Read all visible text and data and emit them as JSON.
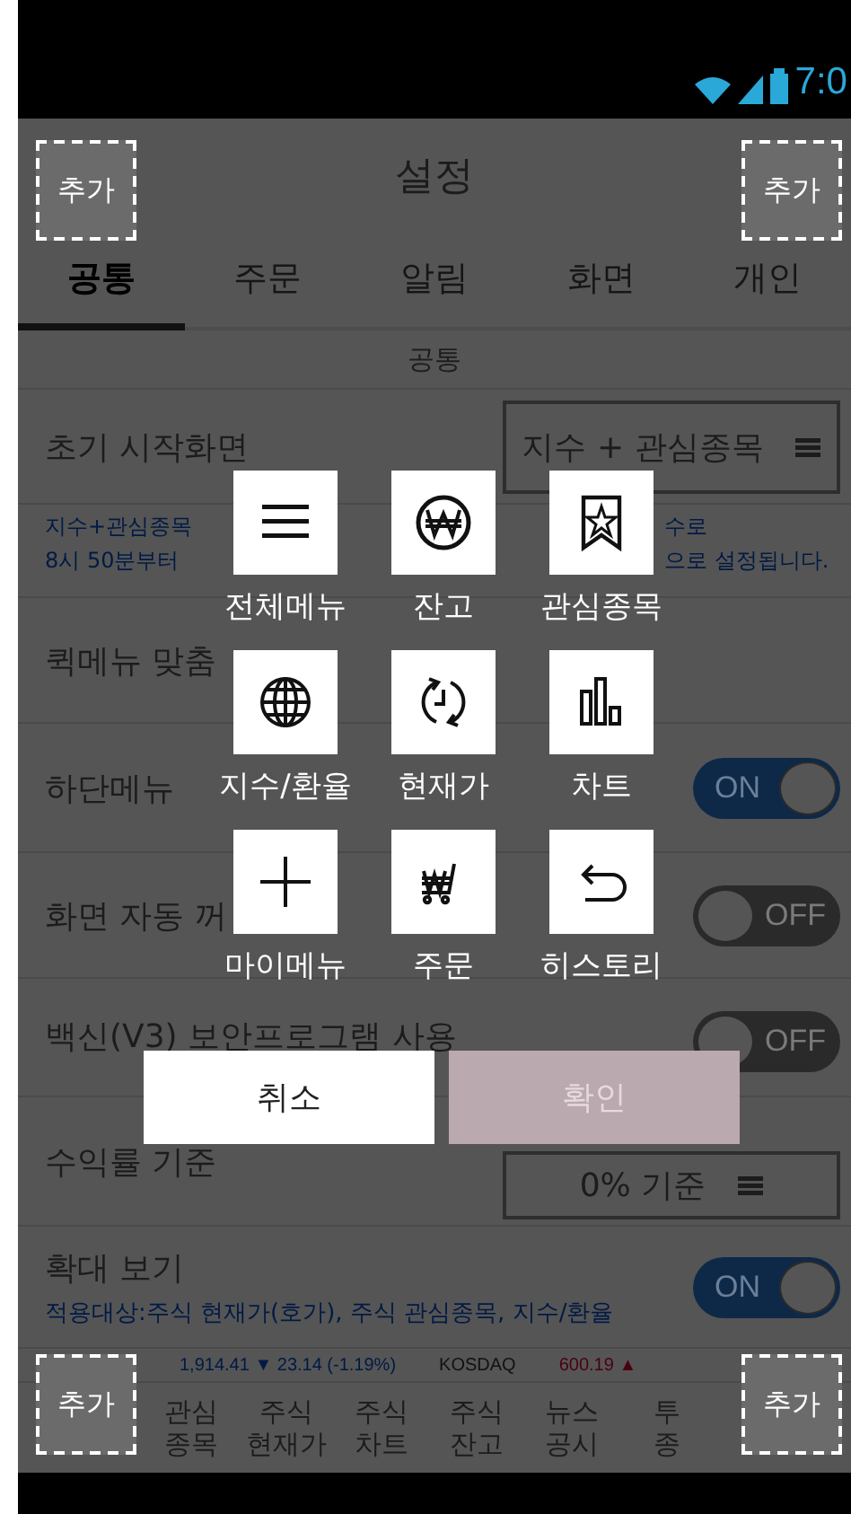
{
  "status_bar": {
    "time": "7:0"
  },
  "app_bar": {
    "title": "설정"
  },
  "tabs": [
    {
      "label": "공통",
      "selected": true
    },
    {
      "label": "주문",
      "selected": false
    },
    {
      "label": "알림",
      "selected": false
    },
    {
      "label": "화면",
      "selected": false
    },
    {
      "label": "개인",
      "selected": false
    }
  ],
  "section_header": "공통",
  "settings": [
    {
      "kind": "select",
      "label": "초기 시작화면",
      "value": "지수 + 관심종목",
      "description": [
        {
          "start": "지수+관심종목",
          "end": "수로"
        },
        {
          "start": "8시 50분부터",
          "end": "으로 설정됩니다."
        }
      ]
    },
    {
      "kind": "plain",
      "label": "퀵메뉴 맞춤"
    },
    {
      "kind": "toggle",
      "label": "하단메뉴",
      "on": true,
      "state_text": "ON"
    },
    {
      "kind": "toggle",
      "label": "화면 자동 꺼",
      "on": false,
      "state_text": "OFF"
    },
    {
      "kind": "toggle",
      "label": "백신(V3) 보안프로그램 사용",
      "on": false,
      "state_text": "OFF"
    },
    {
      "kind": "select",
      "label": "수익률 기준",
      "value": "0% 기준"
    },
    {
      "kind": "toggle",
      "label": "확대 보기",
      "on": true,
      "state_text": "ON",
      "note": "적용대상:주식 현재가(호가), 주식 관심종목, 지수/환율"
    }
  ],
  "ticker": [
    {
      "text": "1,914.41 ▼ 23.14 (-1.19%)",
      "color": "#001a44"
    },
    {
      "text": "KOSDAQ",
      "color": "#111111"
    },
    {
      "text": "600.19 ▲",
      "color": "#4a0010"
    }
  ],
  "bottom_nav": [
    {
      "label": "관심\n종목"
    },
    {
      "label": "주식\n현재가"
    },
    {
      "label": "주식\n차트"
    },
    {
      "label": "주식\n잔고"
    },
    {
      "label": "뉴스\n공시"
    },
    {
      "label": "투\n종"
    }
  ],
  "quick_menu": [
    {
      "label": "전체메뉴"
    },
    {
      "label": "잔고"
    },
    {
      "label": "관심종목"
    },
    {
      "label": "지수/환율"
    },
    {
      "label": "현재가"
    },
    {
      "label": "차트"
    },
    {
      "label": "마이메뉴"
    },
    {
      "label": "주문"
    },
    {
      "label": "히스토리"
    }
  ],
  "dialog_buttons": [
    {
      "label": "취소",
      "enabled": true
    },
    {
      "label": "확인",
      "enabled": false
    }
  ],
  "add_slots": [
    {
      "label": "추가"
    },
    {
      "label": "추가"
    },
    {
      "label": "추가"
    },
    {
      "label": "추가"
    }
  ]
}
